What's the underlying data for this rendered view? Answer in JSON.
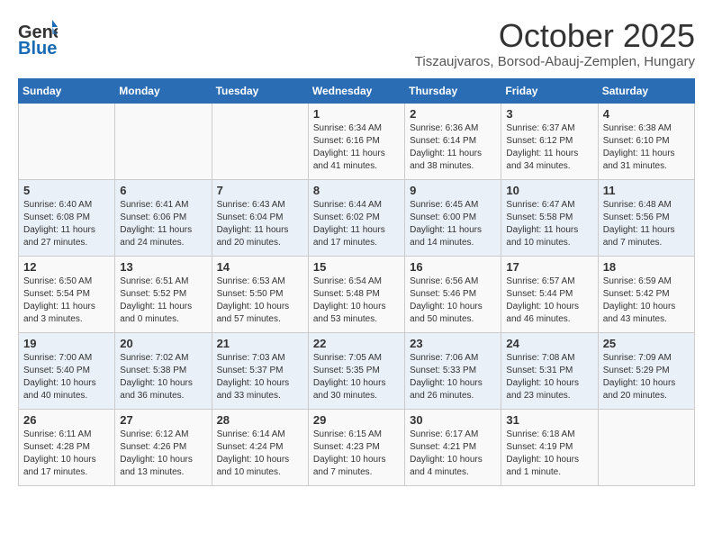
{
  "header": {
    "logo_general": "General",
    "logo_blue": "Blue",
    "month_title": "October 2025",
    "location": "Tiszaujvaros, Borsod-Abauj-Zemplen, Hungary"
  },
  "days_of_week": [
    "Sunday",
    "Monday",
    "Tuesday",
    "Wednesday",
    "Thursday",
    "Friday",
    "Saturday"
  ],
  "weeks": [
    [
      {
        "day": "",
        "info": ""
      },
      {
        "day": "",
        "info": ""
      },
      {
        "day": "",
        "info": ""
      },
      {
        "day": "1",
        "info": "Sunrise: 6:34 AM\nSunset: 6:16 PM\nDaylight: 11 hours and 41 minutes."
      },
      {
        "day": "2",
        "info": "Sunrise: 6:36 AM\nSunset: 6:14 PM\nDaylight: 11 hours and 38 minutes."
      },
      {
        "day": "3",
        "info": "Sunrise: 6:37 AM\nSunset: 6:12 PM\nDaylight: 11 hours and 34 minutes."
      },
      {
        "day": "4",
        "info": "Sunrise: 6:38 AM\nSunset: 6:10 PM\nDaylight: 11 hours and 31 minutes."
      }
    ],
    [
      {
        "day": "5",
        "info": "Sunrise: 6:40 AM\nSunset: 6:08 PM\nDaylight: 11 hours and 27 minutes."
      },
      {
        "day": "6",
        "info": "Sunrise: 6:41 AM\nSunset: 6:06 PM\nDaylight: 11 hours and 24 minutes."
      },
      {
        "day": "7",
        "info": "Sunrise: 6:43 AM\nSunset: 6:04 PM\nDaylight: 11 hours and 20 minutes."
      },
      {
        "day": "8",
        "info": "Sunrise: 6:44 AM\nSunset: 6:02 PM\nDaylight: 11 hours and 17 minutes."
      },
      {
        "day": "9",
        "info": "Sunrise: 6:45 AM\nSunset: 6:00 PM\nDaylight: 11 hours and 14 minutes."
      },
      {
        "day": "10",
        "info": "Sunrise: 6:47 AM\nSunset: 5:58 PM\nDaylight: 11 hours and 10 minutes."
      },
      {
        "day": "11",
        "info": "Sunrise: 6:48 AM\nSunset: 5:56 PM\nDaylight: 11 hours and 7 minutes."
      }
    ],
    [
      {
        "day": "12",
        "info": "Sunrise: 6:50 AM\nSunset: 5:54 PM\nDaylight: 11 hours and 3 minutes."
      },
      {
        "day": "13",
        "info": "Sunrise: 6:51 AM\nSunset: 5:52 PM\nDaylight: 11 hours and 0 minutes."
      },
      {
        "day": "14",
        "info": "Sunrise: 6:53 AM\nSunset: 5:50 PM\nDaylight: 10 hours and 57 minutes."
      },
      {
        "day": "15",
        "info": "Sunrise: 6:54 AM\nSunset: 5:48 PM\nDaylight: 10 hours and 53 minutes."
      },
      {
        "day": "16",
        "info": "Sunrise: 6:56 AM\nSunset: 5:46 PM\nDaylight: 10 hours and 50 minutes."
      },
      {
        "day": "17",
        "info": "Sunrise: 6:57 AM\nSunset: 5:44 PM\nDaylight: 10 hours and 46 minutes."
      },
      {
        "day": "18",
        "info": "Sunrise: 6:59 AM\nSunset: 5:42 PM\nDaylight: 10 hours and 43 minutes."
      }
    ],
    [
      {
        "day": "19",
        "info": "Sunrise: 7:00 AM\nSunset: 5:40 PM\nDaylight: 10 hours and 40 minutes."
      },
      {
        "day": "20",
        "info": "Sunrise: 7:02 AM\nSunset: 5:38 PM\nDaylight: 10 hours and 36 minutes."
      },
      {
        "day": "21",
        "info": "Sunrise: 7:03 AM\nSunset: 5:37 PM\nDaylight: 10 hours and 33 minutes."
      },
      {
        "day": "22",
        "info": "Sunrise: 7:05 AM\nSunset: 5:35 PM\nDaylight: 10 hours and 30 minutes."
      },
      {
        "day": "23",
        "info": "Sunrise: 7:06 AM\nSunset: 5:33 PM\nDaylight: 10 hours and 26 minutes."
      },
      {
        "day": "24",
        "info": "Sunrise: 7:08 AM\nSunset: 5:31 PM\nDaylight: 10 hours and 23 minutes."
      },
      {
        "day": "25",
        "info": "Sunrise: 7:09 AM\nSunset: 5:29 PM\nDaylight: 10 hours and 20 minutes."
      }
    ],
    [
      {
        "day": "26",
        "info": "Sunrise: 6:11 AM\nSunset: 4:28 PM\nDaylight: 10 hours and 17 minutes."
      },
      {
        "day": "27",
        "info": "Sunrise: 6:12 AM\nSunset: 4:26 PM\nDaylight: 10 hours and 13 minutes."
      },
      {
        "day": "28",
        "info": "Sunrise: 6:14 AM\nSunset: 4:24 PM\nDaylight: 10 hours and 10 minutes."
      },
      {
        "day": "29",
        "info": "Sunrise: 6:15 AM\nSunset: 4:23 PM\nDaylight: 10 hours and 7 minutes."
      },
      {
        "day": "30",
        "info": "Sunrise: 6:17 AM\nSunset: 4:21 PM\nDaylight: 10 hours and 4 minutes."
      },
      {
        "day": "31",
        "info": "Sunrise: 6:18 AM\nSunset: 4:19 PM\nDaylight: 10 hours and 1 minute."
      },
      {
        "day": "",
        "info": ""
      }
    ]
  ]
}
